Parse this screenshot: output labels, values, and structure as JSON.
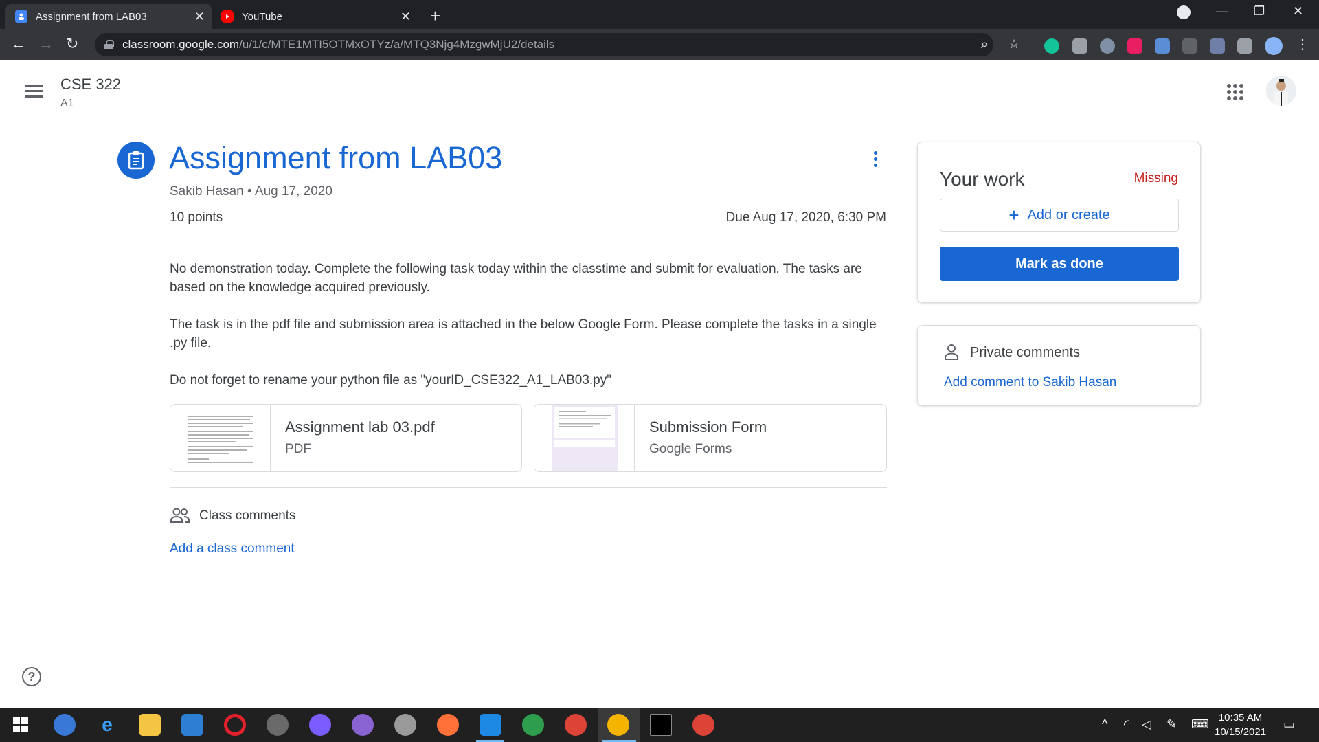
{
  "browser": {
    "tabs": [
      {
        "title": "Assignment from LAB03",
        "active": true
      },
      {
        "title": "YouTube",
        "active": false
      }
    ],
    "url_host": "classroom.google.com",
    "url_path": "/u/1/c/MTE1MTI5OTMxOTYz/a/MTQ3Njg4MzgwMjU2/details"
  },
  "header": {
    "class_name": "CSE 322",
    "section": "A1"
  },
  "assignment": {
    "title": "Assignment from LAB03",
    "author": "Sakib Hasan",
    "date": "Aug 17, 2020",
    "points": "10 points",
    "due": "Due Aug 17, 2020, 6:30 PM",
    "paragraphs": [
      "No demonstration today. Complete the following task today within the classtime and submit for evaluation. The tasks are based on the knowledge acquired previously.",
      "The task is in the pdf file and submission area is attached in the below Google Form. Please complete the tasks in a single .py file.",
      "Do not forget to rename your python file as \"yourID_CSE322_A1_LAB03.py\""
    ],
    "attachments": [
      {
        "name": "Assignment lab 03.pdf",
        "type": "PDF"
      },
      {
        "name": "Submission Form",
        "type": "Google Forms"
      }
    ]
  },
  "class_comments": {
    "label": "Class comments",
    "add": "Add a class comment"
  },
  "your_work": {
    "title": "Your work",
    "status": "Missing",
    "add_create": "Add or create",
    "mark_done": "Mark as done"
  },
  "private_comments": {
    "title": "Private comments",
    "add": "Add comment to Sakib Hasan"
  },
  "help_label": "?",
  "taskbar": {
    "time": "10:35 AM",
    "date": "10/15/2021"
  },
  "colors": {
    "accent": "#1967d2",
    "missing": "#c5221f"
  }
}
